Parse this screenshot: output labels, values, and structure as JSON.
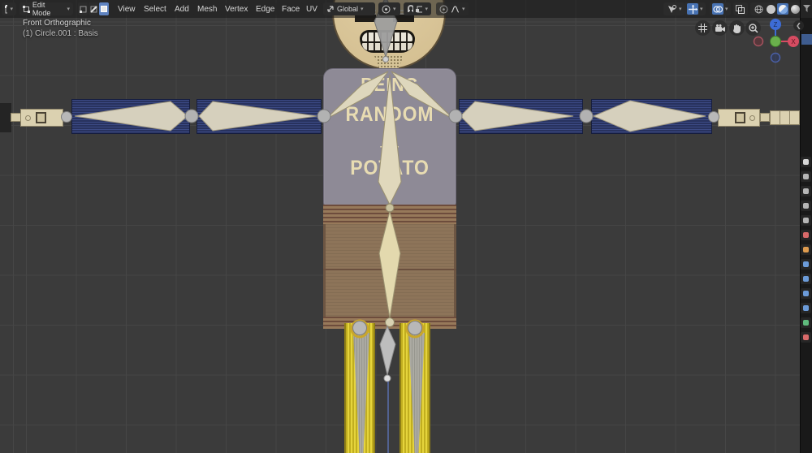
{
  "header": {
    "editor_icon": "viewport-editor-type-icon",
    "mode_label": "Edit Mode",
    "select_modes": [
      "vertex",
      "edge",
      "face"
    ],
    "active_select_mode": "face",
    "menus": [
      "View",
      "Select",
      "Add",
      "Mesh",
      "Vertex",
      "Edge",
      "Face",
      "UV"
    ],
    "orientation_label": "Global",
    "pivot_icon": "pivot-point-icon",
    "snap_icon": "magnet-icon",
    "proportional_icon": "proportional-editing-icon",
    "falloff_icon": "falloff-curve-icon",
    "right_icons": [
      "object-visibility-icon",
      "show-gizmo-icon",
      "show-overlays-icon",
      "xray-toggle-icon"
    ],
    "shading_modes": [
      "wireframe",
      "solid",
      "material-preview",
      "rendered"
    ],
    "active_shading_mode": "material-preview"
  },
  "viewport": {
    "overlay_line1": "Front Orthographic",
    "overlay_line2": "(1) Circle.001 : Basis",
    "nav_buttons": [
      "grid-icon",
      "camera-icon",
      "hand-icon",
      "zoom-icon"
    ],
    "gizmo": {
      "x_label": "X",
      "z_label": "Z"
    },
    "collapse_arrow": "❮"
  },
  "model": {
    "shirt_text_line1": "BEING",
    "shirt_text_line2": "RANDOM",
    "shirt_text_line3": "- a -",
    "shirt_text_line4": "POTATO"
  },
  "right_panel": {
    "tabs": [
      {
        "name": "tool-tab",
        "color": "#d8d8d8"
      },
      {
        "name": "render-tab",
        "color": "#b5b5b5"
      },
      {
        "name": "output-tab",
        "color": "#b5b5b5"
      },
      {
        "name": "view-layer-tab",
        "color": "#b5b5b5"
      },
      {
        "name": "scene-tab",
        "color": "#b5b5b5"
      },
      {
        "name": "world-tab",
        "color": "#d96a6a"
      },
      {
        "name": "object-tab",
        "color": "#de9b4e"
      },
      {
        "name": "modifiers-tab",
        "color": "#6b9bd9"
      },
      {
        "name": "particles-tab",
        "color": "#6b9bd9"
      },
      {
        "name": "physics-tab",
        "color": "#6b9bd9"
      },
      {
        "name": "constraints-tab",
        "color": "#6b9bd9"
      },
      {
        "name": "object-data-tab",
        "color": "#5fba7d"
      },
      {
        "name": "material-tab",
        "color": "#d96a6a"
      }
    ]
  },
  "colors": {
    "accent_blue": "#4772b3",
    "viewport_bg": "#3b3b3b",
    "grid_line": "#464646",
    "shirt": "#8e8a96",
    "shirt_text": "#e8dcb2",
    "pants": "#8d7459",
    "sleeve_blue": "#28325e",
    "leg_yellow": "#e5d43c",
    "bone_cream": "#d6d0bd",
    "skin_cream": "#d9c69c",
    "axis_x_red": "#d64c62",
    "axis_y_green": "#6ab04c",
    "axis_z_blue": "#3d6cd6"
  }
}
